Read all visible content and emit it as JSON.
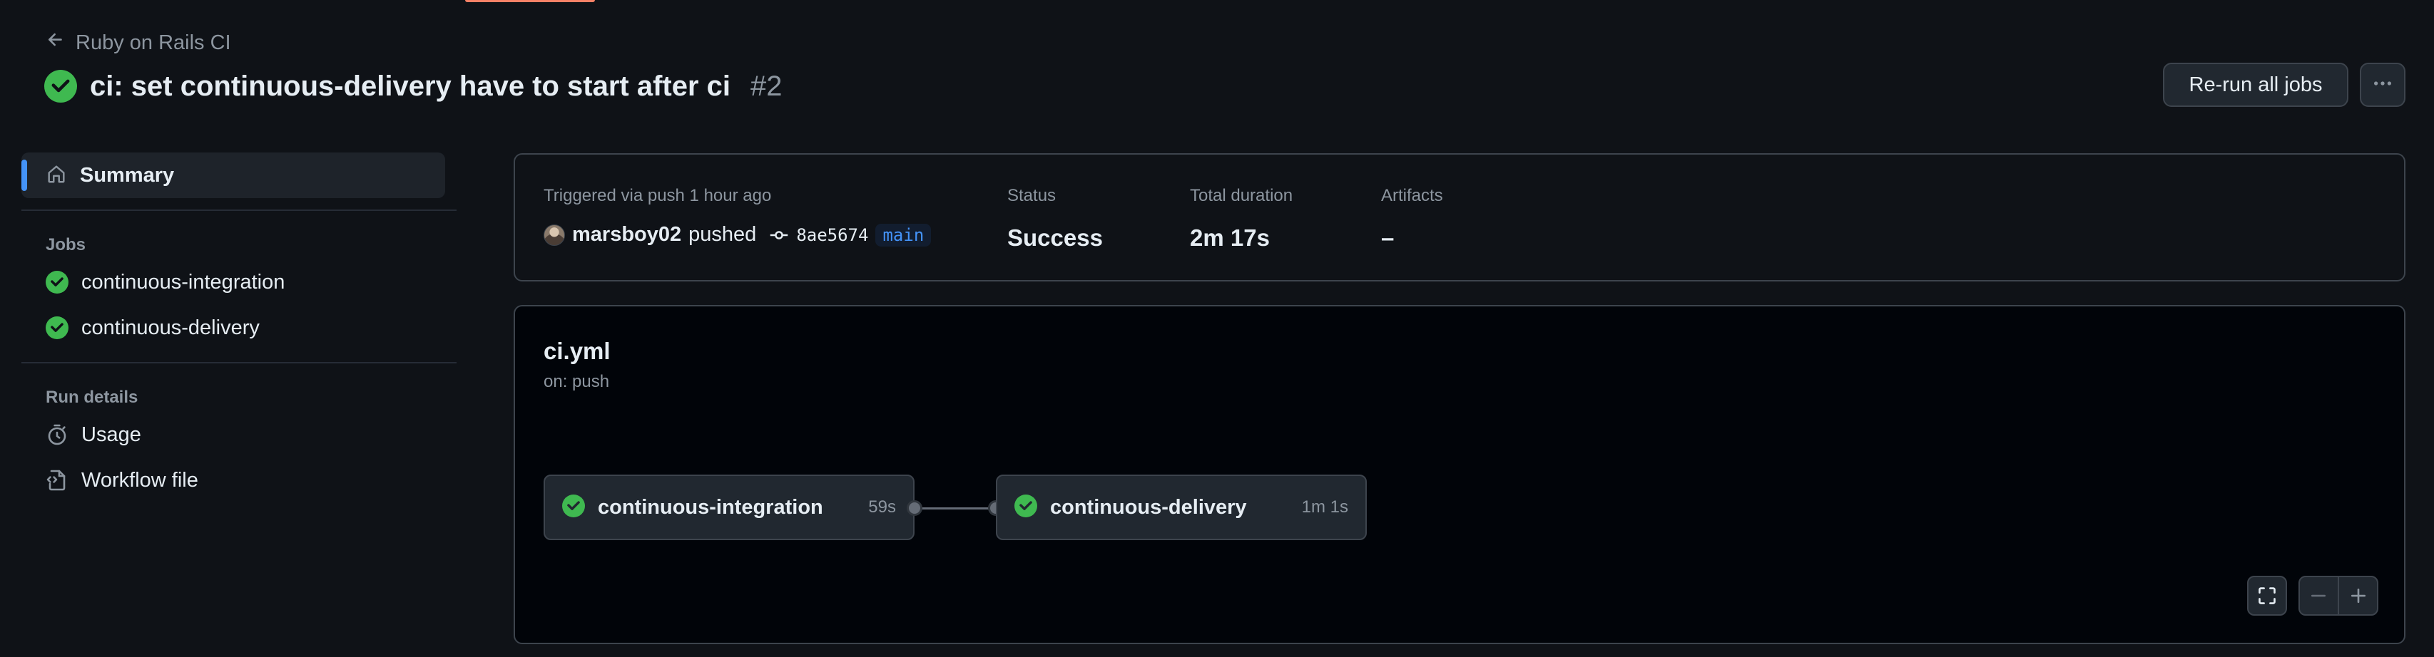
{
  "header": {
    "back_label": "Ruby on Rails CI",
    "run_title": "ci: set continuous-delivery have to start after ci",
    "run_number": "#2",
    "rerun_label": "Re-run all jobs"
  },
  "sidebar": {
    "summary_label": "Summary",
    "jobs_title": "Jobs",
    "jobs": [
      {
        "label": "continuous-integration"
      },
      {
        "label": "continuous-delivery"
      }
    ],
    "run_details_title": "Run details",
    "details": [
      {
        "label": "Usage"
      },
      {
        "label": "Workflow file"
      }
    ]
  },
  "summary": {
    "trigger_text": "Triggered via push 1 hour ago",
    "actor": "marsboy02",
    "actor_action": "pushed",
    "commit_sha": "8ae5674",
    "branch": "main",
    "status_label": "Status",
    "status_value": "Success",
    "duration_label": "Total duration",
    "duration_value": "2m 17s",
    "artifacts_label": "Artifacts",
    "artifacts_value": "–"
  },
  "workflow": {
    "file_name": "ci.yml",
    "trigger": "on: push",
    "jobs": [
      {
        "name": "continuous-integration",
        "duration": "59s"
      },
      {
        "name": "continuous-delivery",
        "duration": "1m 1s"
      }
    ]
  },
  "colors": {
    "accent": "#4493f8",
    "success": "#3fb950",
    "background": "#0f1217"
  }
}
